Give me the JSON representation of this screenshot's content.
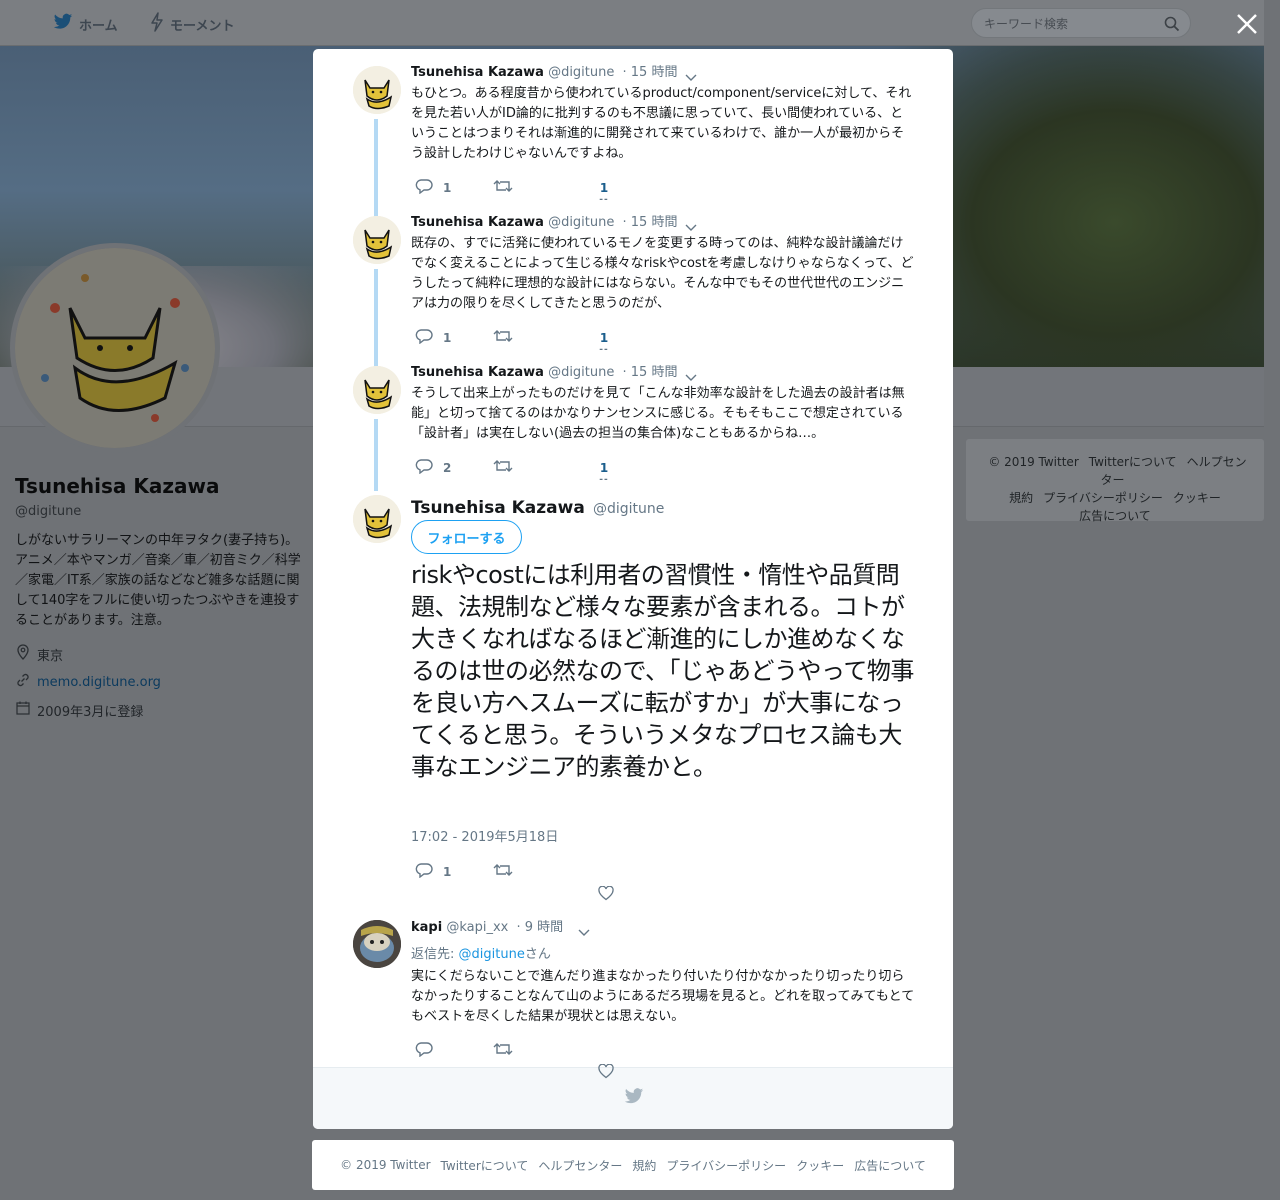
{
  "topbar": {
    "home_label": "ホーム",
    "moments_label": "モーメント",
    "search_placeholder": "キーワード検索"
  },
  "profile": {
    "name": "Tsunehisa Kazawa",
    "handle": "@digitune",
    "bio": "しがないサラリーマンの中年ヲタク(妻子持ち)。アニメ／本やマンガ／音楽／車／初音ミク／科学／家電／IT系／家族の話などなど雑多な話題に関して140字をフルに使い切ったつぶやきを連投することがあります。注意。",
    "location": "東京",
    "url": "memo.digitune.org",
    "joined": "2009年3月に登録"
  },
  "sidebar_footer": {
    "copyright": "© 2019 Twitter",
    "about": "Twitterについて",
    "help": "ヘルプセンター",
    "terms": "規約",
    "privacy": "プライバシーポリシー",
    "cookies": "クッキー",
    "ads": "広告について"
  },
  "thread": [
    {
      "name": "Tsunehisa Kazawa",
      "handle": "@digitune",
      "time": "· 15 時間",
      "text": "もひとつ。ある程度昔から使われているproduct/component/serviceに対して、それを見た若い人がID論的に批判するのも不思議に思っていて、長い間使われている、ということはつまりそれは漸進的に開発されて来ているわけで、誰か一人が最初からそう設計したわけじゃないんですよね。",
      "replies": "1",
      "likes": "1"
    },
    {
      "name": "Tsunehisa Kazawa",
      "handle": "@digitune",
      "time": "· 15 時間",
      "text": "既存の、すでに活発に使われているモノを変更する時ってのは、純粋な設計議論だけでなく変えることによって生じる様々なriskやcostを考慮しなけりゃならなくって、どうしたって純粋に理想的な設計にはならない。そんな中でもその世代世代のエンジニアは力の限りを尽くしてきたと思うのだが、",
      "replies": "1",
      "likes": "1"
    },
    {
      "name": "Tsunehisa Kazawa",
      "handle": "@digitune",
      "time": "· 15 時間",
      "text": "そうして出来上がったものだけを見て「こんな非効率な設計をした過去の設計者は無能」と切って捨てるのはかなりナンセンスに感じる。そもそもここで想定されている「設計者」は実在しない(過去の担当の集合体)なこともあるからね…。",
      "replies": "2",
      "likes": "1"
    }
  ],
  "main_tweet": {
    "name": "Tsunehisa Kazawa",
    "handle": "@digitune",
    "follow_label": "フォローする",
    "text": "riskやcostには利用者の習慣性・惰性や品質問題、法規制など様々な要素が含まれる。コトが大きくなればなるほど漸進的にしか進めなくなるのは世の必然なので、「じゃあどうやって物事を良い方へスムーズに転がすか」が大事になってくると思う。そういうメタなプロセス論も大事なエンジニア的素養かと。",
    "date": "17:02 - 2019年5月18日",
    "replies": "1"
  },
  "reply": {
    "name": "kapi",
    "handle": "@kapi_xx",
    "time": "· 9 時間",
    "reply_prefix": "返信先: ",
    "reply_to": "@digitune",
    "reply_suffix": "さん",
    "text": "実にくだらないことで進んだり進まなかったり付いたり付かなかったり切ったり切らなかったりすることなんて山のようにあるだろ現場を見ると。どれを取ってみてもとてもベストを尽くした結果が現状とは思えない。"
  },
  "page_footer": {
    "copyright": "© 2019 Twitter",
    "about": "Twitterについて",
    "help": "ヘルプセンター",
    "terms": "規約",
    "privacy": "プライバシーポリシー",
    "cookies": "クッキー",
    "ads": "広告について"
  },
  "colors": {
    "twitter_blue": "#1da1f2",
    "thread_line": "#b4d9f4",
    "overlay": "#6f7276"
  }
}
